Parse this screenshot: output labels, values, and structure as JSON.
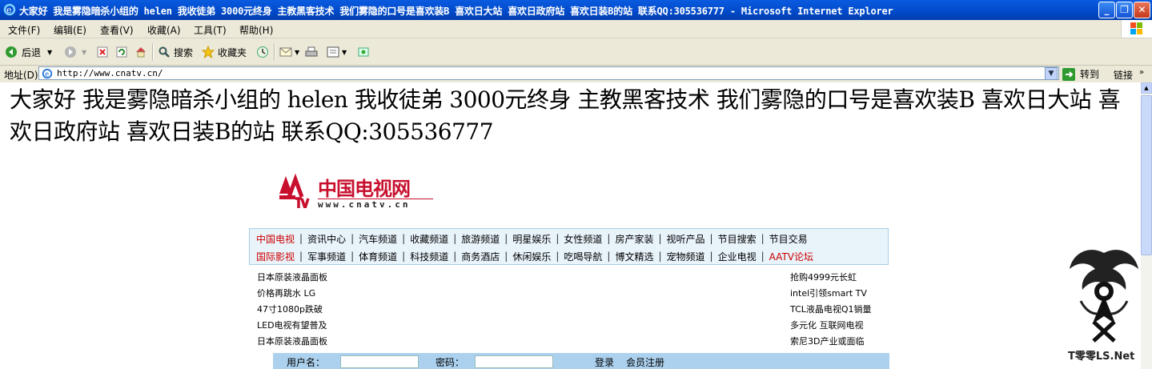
{
  "window": {
    "title": "大家好 我是雾隐暗杀小组的 helen 我收徒弟 3000元终身 主教黑客技术 我们雾隐的口号是喜欢装B 喜欢日大站 喜欢日政府站 喜欢日装B的站 联系QQ:305536777 - Microsoft Internet Explorer",
    "controls": {
      "minimize": "_",
      "maximize": "❐",
      "close": "✕"
    }
  },
  "menu": [
    "文件(F)",
    "编辑(E)",
    "查看(V)",
    "收藏(A)",
    "工具(T)",
    "帮助(H)"
  ],
  "toolbar": {
    "back": "后退",
    "search": "搜索",
    "favorites": "收藏夹"
  },
  "address": {
    "label": "地址(D)",
    "url": "http://www.cnatv.cn/",
    "go": "转到",
    "links": "链接"
  },
  "page": {
    "defacement_text": "大家好 我是雾隐暗杀小组的 helen 我收徒弟 3000元终身 主教黑客技术 我们雾隐的口号是喜欢装B 喜欢日大站 喜欢日政府站 喜欢日装B的站 联系QQ:305536777",
    "logo": {
      "brand": "中国电视网",
      "domain": "www.cnatv.cn"
    },
    "nav_row1": [
      "中国电视",
      "资讯中心",
      "汽车频道",
      "收藏频道",
      "旅游频道",
      "明星娱乐",
      "女性频道",
      "房产家装",
      "视听产品",
      "节目搜索",
      "节目交易"
    ],
    "nav_row2": [
      "国际影视",
      "军事频道",
      "体育频道",
      "科技频道",
      "商务酒店",
      "休闲娱乐",
      "吃喝导航",
      "博文精选",
      "宠物频道",
      "企业电视",
      "AATV论坛"
    ],
    "ads_left": [
      "日本原装液晶面板",
      "价格再跳水 LG",
      "47寸1080p跌破",
      "LED电视有望普及",
      "日本原装液晶面板"
    ],
    "ads_right": [
      "抢购4999元长虹",
      "intel引领smart TV",
      "TCL液晶电视Q1销量",
      "多元化 互联网电视",
      "索尼3D产业或面临"
    ],
    "login": {
      "username_label": "用户名：",
      "password_label": "密码：",
      "login_link": "登录",
      "register_link": "会员注册"
    },
    "watermark": "T零零LS.Net"
  },
  "colors": {
    "accent_red": "#cc0000",
    "titlebar_blue": "#0a5be0",
    "nav_bg": "#e8f3fa",
    "login_bg": "#acd1ee"
  }
}
